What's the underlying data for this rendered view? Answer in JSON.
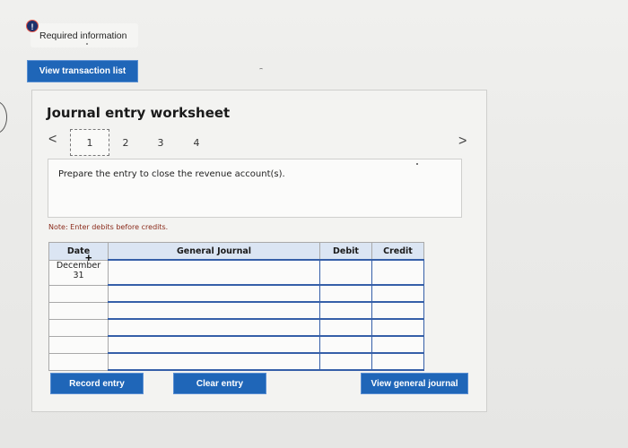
{
  "required": {
    "badge": "!",
    "label": "Required information"
  },
  "buttons": {
    "view_transaction_list": "View transaction list",
    "record_entry": "Record entry",
    "clear_entry": "Clear entry",
    "view_general_journal": "View general journal"
  },
  "worksheet": {
    "title": "Journal entry worksheet",
    "nav_prev": "<",
    "nav_next": ">",
    "steps": [
      "1",
      "2",
      "3",
      "4"
    ],
    "active_step": "1",
    "prompt": "Prepare the entry to close the revenue account(s).",
    "note": "Note: Enter debits before credits."
  },
  "journal_table": {
    "headers": {
      "date": "Date",
      "general_journal": "General Journal",
      "debit": "Debit",
      "credit": "Credit"
    },
    "rows": [
      {
        "date_line1": "December",
        "date_line2": "31",
        "account": "",
        "debit": "",
        "credit": ""
      },
      {
        "date_line1": "",
        "date_line2": "",
        "account": "",
        "debit": "",
        "credit": ""
      },
      {
        "date_line1": "",
        "date_line2": "",
        "account": "",
        "debit": "",
        "credit": ""
      },
      {
        "date_line1": "",
        "date_line2": "",
        "account": "",
        "debit": "",
        "credit": ""
      },
      {
        "date_line1": "",
        "date_line2": "",
        "account": "",
        "debit": "",
        "credit": ""
      },
      {
        "date_line1": "",
        "date_line2": "",
        "account": "",
        "debit": "",
        "credit": ""
      }
    ]
  },
  "icons": {
    "badge": "alert-circle-icon",
    "cursor": "crosshair-cursor-icon"
  },
  "colors": {
    "primary_button": "#1f66b8",
    "badge_bg": "#1e2f6b",
    "table_header_bg": "#dbe5f3",
    "input_border": "#355fa8",
    "note_text": "#8a2a1a"
  }
}
